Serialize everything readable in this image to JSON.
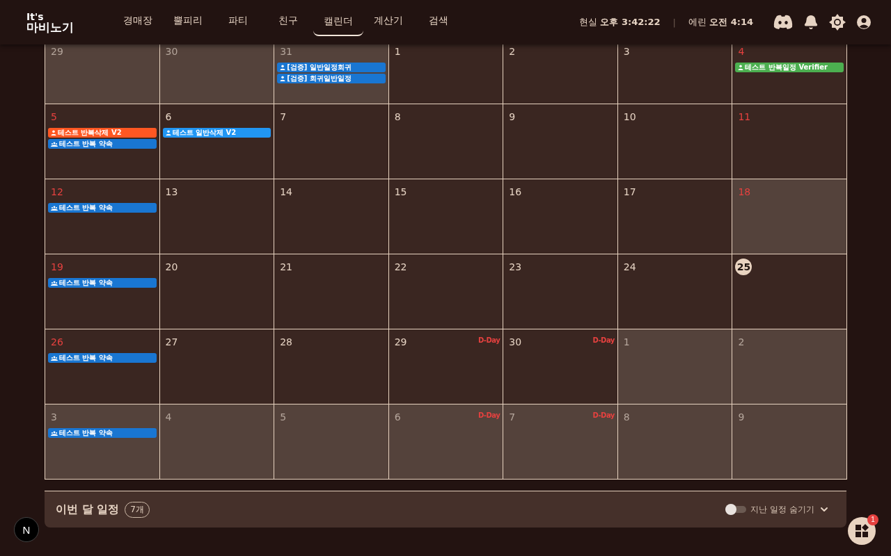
{
  "logo": {
    "line1": "It's",
    "line2": "마비노기"
  },
  "nav": [
    {
      "label": "경매장",
      "selected": false
    },
    {
      "label": "뿔피리",
      "selected": false
    },
    {
      "label": "파티",
      "selected": false
    },
    {
      "label": "친구",
      "selected": false
    },
    {
      "label": "캘린더",
      "selected": true
    },
    {
      "label": "계산기",
      "selected": false
    },
    {
      "label": "검색",
      "selected": false
    }
  ],
  "clock": {
    "real_label": "현실",
    "real_time": "오후 3:42:22",
    "separator": "|",
    "erinn_label": "에린",
    "erinn_time": "오전 4:14"
  },
  "weeks": [
    [
      {
        "date": "29",
        "kind": "other",
        "shaded": true
      },
      {
        "date": "30",
        "kind": "other",
        "shaded": true
      },
      {
        "date": "31",
        "kind": "other",
        "shaded": true,
        "events": [
          {
            "label": "[검증] 일반일정회귀",
            "kind": "single",
            "color": "#1976d2"
          },
          {
            "label": "[검증] 회귀일반일정",
            "kind": "single",
            "color": "#1976d2"
          }
        ]
      },
      {
        "date": "1",
        "kind": "normal",
        "shaded": false
      },
      {
        "date": "2",
        "kind": "normal",
        "shaded": false
      },
      {
        "date": "3",
        "kind": "normal",
        "shaded": false
      },
      {
        "date": "4",
        "kind": "weekend",
        "shaded": false,
        "events": [
          {
            "label": "테스트 반복일정 Verifier",
            "kind": "single",
            "color": "#4caf50"
          }
        ]
      }
    ],
    [
      {
        "date": "5",
        "kind": "weekend",
        "shaded": false,
        "events": [
          {
            "label": "테스트 반복삭제 V2",
            "kind": "single",
            "color": "#ff5722"
          },
          {
            "label": "테스트 반복 약속",
            "kind": "shared",
            "color": "#1976d2"
          }
        ]
      },
      {
        "date": "6",
        "kind": "normal",
        "shaded": false,
        "events": [
          {
            "label": "테스트 일반삭제 V2",
            "kind": "single",
            "color": "#2196f3"
          }
        ]
      },
      {
        "date": "7",
        "kind": "normal",
        "shaded": false
      },
      {
        "date": "8",
        "kind": "normal",
        "shaded": false
      },
      {
        "date": "9",
        "kind": "normal",
        "shaded": false
      },
      {
        "date": "10",
        "kind": "normal",
        "shaded": false
      },
      {
        "date": "11",
        "kind": "weekend",
        "shaded": false
      }
    ],
    [
      {
        "date": "12",
        "kind": "weekend",
        "shaded": false,
        "events": [
          {
            "label": "테스트 반복 약속",
            "kind": "shared",
            "color": "#1976d2"
          }
        ]
      },
      {
        "date": "13",
        "kind": "normal",
        "shaded": false
      },
      {
        "date": "14",
        "kind": "normal",
        "shaded": false
      },
      {
        "date": "15",
        "kind": "normal",
        "shaded": false
      },
      {
        "date": "16",
        "kind": "normal",
        "shaded": false
      },
      {
        "date": "17",
        "kind": "normal",
        "shaded": false
      },
      {
        "date": "18",
        "kind": "weekend",
        "shaded": true
      }
    ],
    [
      {
        "date": "19",
        "kind": "weekend",
        "shaded": false,
        "events": [
          {
            "label": "테스트 반복 약속",
            "kind": "shared",
            "color": "#1976d2"
          }
        ]
      },
      {
        "date": "20",
        "kind": "normal",
        "shaded": false
      },
      {
        "date": "21",
        "kind": "normal",
        "shaded": false
      },
      {
        "date": "22",
        "kind": "normal",
        "shaded": false
      },
      {
        "date": "23",
        "kind": "normal",
        "shaded": false
      },
      {
        "date": "24",
        "kind": "normal",
        "shaded": false
      },
      {
        "date": "25",
        "kind": "today",
        "shaded": false
      }
    ],
    [
      {
        "date": "26",
        "kind": "weekend",
        "shaded": false,
        "events": [
          {
            "label": "테스트 반복 약속",
            "kind": "shared",
            "color": "#1976d2"
          }
        ]
      },
      {
        "date": "27",
        "kind": "normal",
        "shaded": false
      },
      {
        "date": "28",
        "kind": "normal",
        "shaded": false
      },
      {
        "date": "29",
        "kind": "normal",
        "shaded": false,
        "dday": "D-Day"
      },
      {
        "date": "30",
        "kind": "normal",
        "shaded": false,
        "dday": "D-Day"
      },
      {
        "date": "1",
        "kind": "other",
        "shaded": true
      },
      {
        "date": "2",
        "kind": "other",
        "shaded": true
      }
    ],
    [
      {
        "date": "3",
        "kind": "other",
        "shaded": true,
        "events": [
          {
            "label": "테스트 반복 약속",
            "kind": "shared",
            "color": "#1976d2"
          }
        ]
      },
      {
        "date": "4",
        "kind": "other",
        "shaded": true
      },
      {
        "date": "5",
        "kind": "other",
        "shaded": true
      },
      {
        "date": "6",
        "kind": "other",
        "shaded": true,
        "dday": "D-Day"
      },
      {
        "date": "7",
        "kind": "other",
        "shaded": true,
        "dday": "D-Day"
      },
      {
        "date": "8",
        "kind": "other",
        "shaded": true
      },
      {
        "date": "9",
        "kind": "other",
        "shaded": true
      }
    ]
  ],
  "summary": {
    "title": "이번 달 일정",
    "count": "7개",
    "hide_past": {
      "label": "지난 일정 숨기기",
      "on": false
    }
  },
  "dev_badge": "N",
  "widget": {
    "badge": "1"
  }
}
